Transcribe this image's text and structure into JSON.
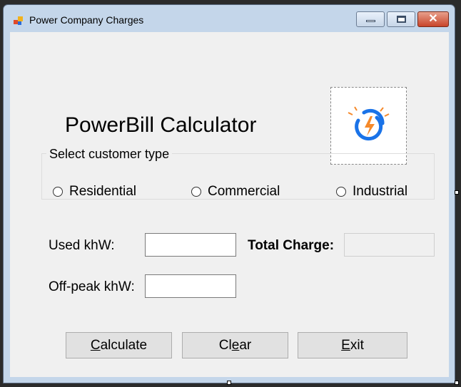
{
  "window": {
    "title": "Power Company Charges",
    "close_glyph": "✕"
  },
  "form": {
    "heading": "PowerBill Calculator",
    "logo_icon": "power-bolt-icon",
    "customer_type": {
      "legend": "Select customer type",
      "options": [
        "Residential",
        "Commercial",
        "Industrial"
      ],
      "selected": null
    },
    "used_kwh": {
      "label": "Used khW:",
      "value": ""
    },
    "offpeak_kwh": {
      "label": "Off-peak khW:",
      "value": ""
    },
    "total_charge": {
      "label": "Total Charge:",
      "value": ""
    },
    "buttons": {
      "calculate": {
        "mnemonic": "C",
        "rest": "alculate"
      },
      "clear": {
        "pre": "Cl",
        "mnemonic": "e",
        "post": "ar"
      },
      "exit": {
        "mnemonic": "E",
        "rest": "xit"
      }
    }
  },
  "colors": {
    "accent_blue": "#1a73e8",
    "accent_orange": "#f5892a",
    "window_frame": "#c4d6ea",
    "client_bg": "#f0f0f0"
  }
}
